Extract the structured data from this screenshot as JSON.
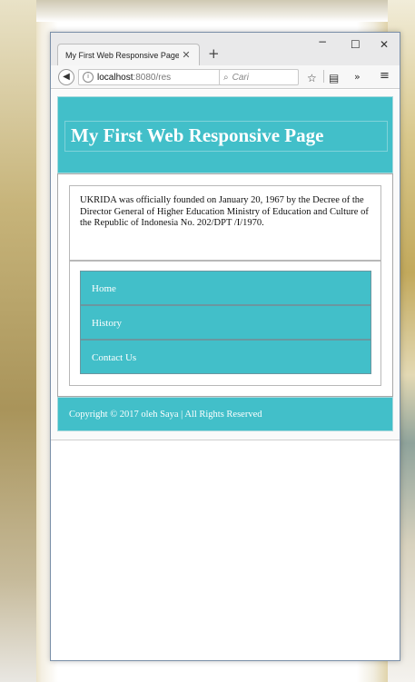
{
  "browser": {
    "tab_title": "My First Web Responsive Page",
    "tab_close_icon": "close-icon",
    "new_tab_label": "+",
    "window_controls": {
      "minimize": "−",
      "maximize": "☐",
      "close": "✕"
    },
    "url_host": "localhost",
    "url_rest": ":8080/res",
    "search_placeholder": "Cari",
    "toolbar_icons": [
      "back-arrow-icon",
      "info-icon",
      "reload-icon",
      "search-icon",
      "star-icon",
      "reader-icon",
      "overflow-icon",
      "menu-icon"
    ]
  },
  "page": {
    "header_title": "My First Web Responsive Page",
    "article_text": "UKRIDA was officially founded on January 20, 1967 by the Decree of the Director General of Higher Education Ministry of Education and Culture of the Republic of Indonesia No. 202/DPT /I/1970.",
    "nav_items": [
      "Home",
      "History",
      "Contact Us"
    ],
    "footer_text": "Copyright © 2017 oleh Saya | All Rights Reserved"
  },
  "colors": {
    "accent": "#42bfc9",
    "header_text": "#ffffff"
  }
}
